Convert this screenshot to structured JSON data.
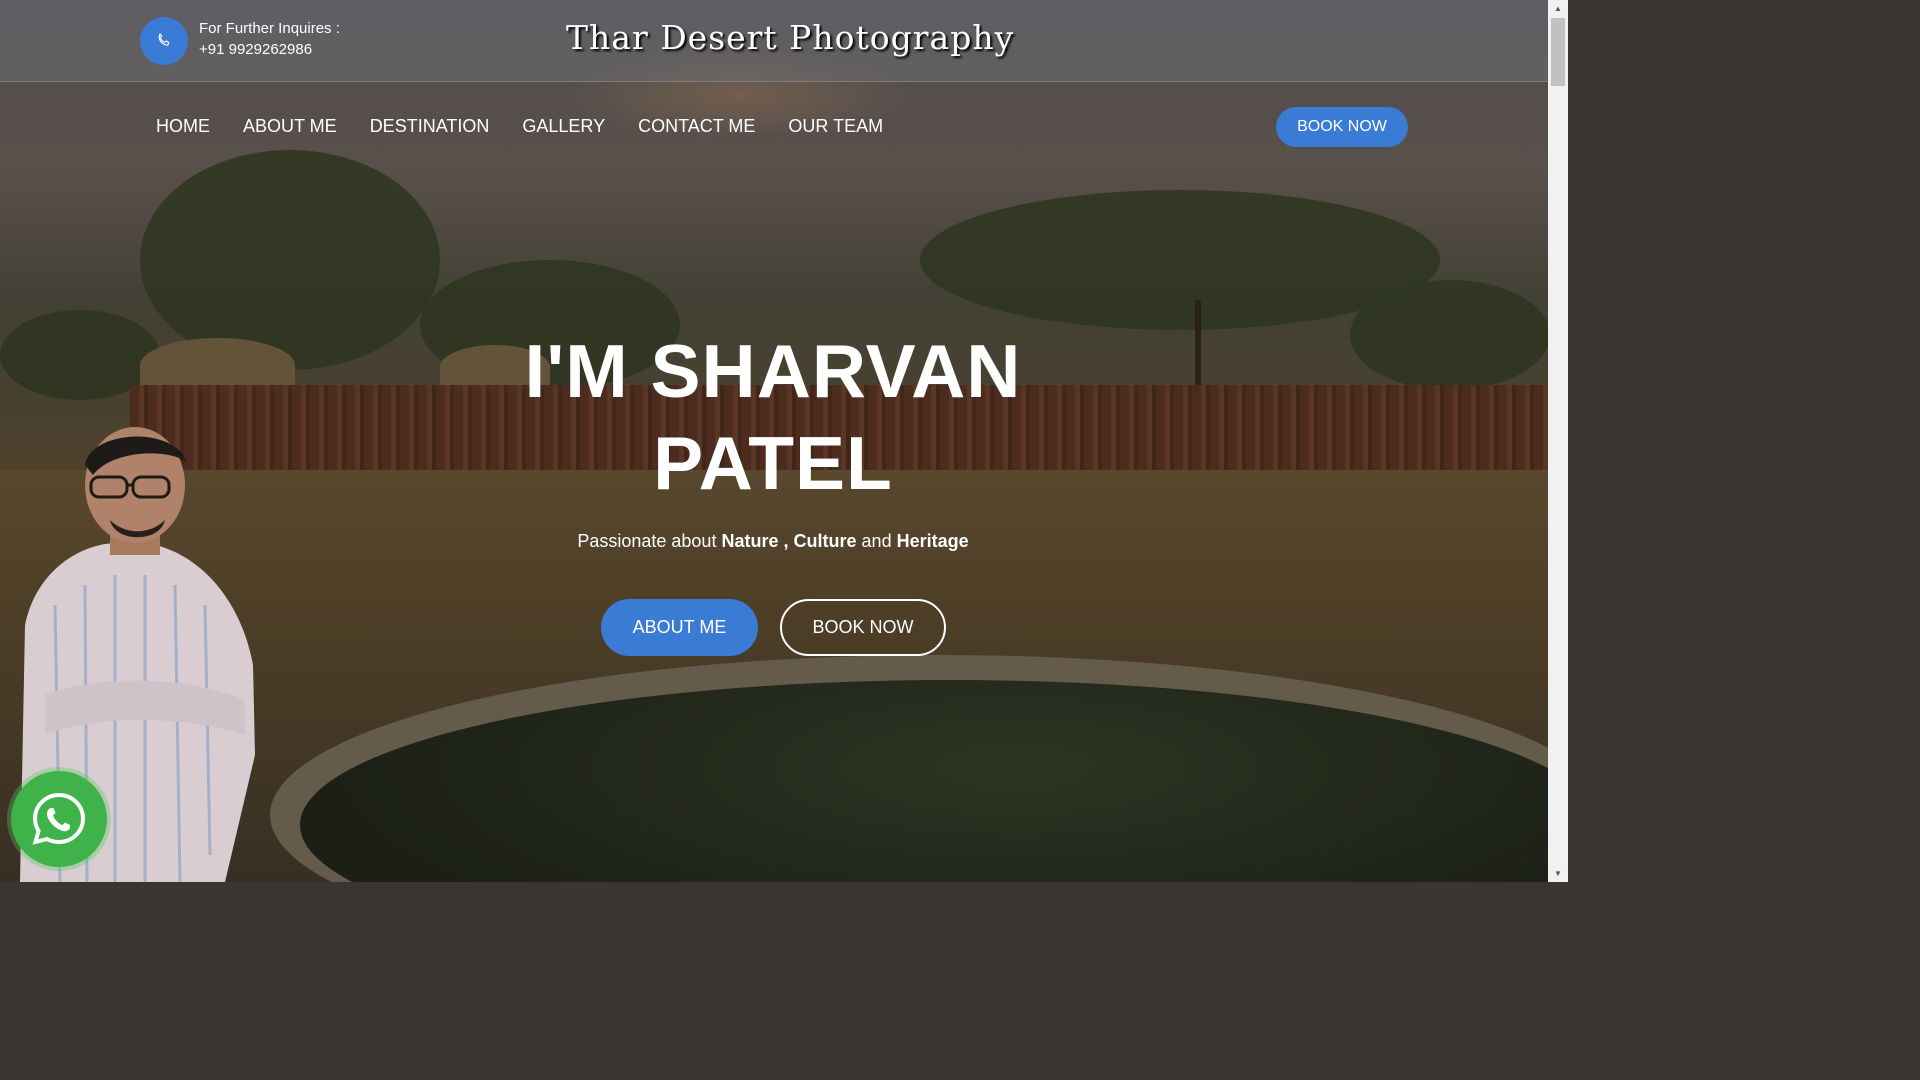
{
  "header": {
    "inquiry_label": "For Further Inquires :",
    "phone": "+91 9929262986",
    "site_title": "Thar Desert Photography",
    "icon": "phone-icon"
  },
  "nav": {
    "items": [
      "HOME",
      "ABOUT ME",
      "DESTINATION",
      "GALLERY",
      "CONTACT ME",
      "OUR TEAM"
    ],
    "book_label": "BOOK NOW"
  },
  "hero": {
    "headline_line1": "I'M SHARVAN",
    "headline_line2": "PATEL",
    "tagline_prefix": "Passionate about",
    "tagline_word1": "Nature",
    "tagline_sep": ",",
    "tagline_word2": "Culture",
    "tagline_and": "and",
    "tagline_word3": "Heritage",
    "about_button": "ABOUT ME",
    "book_button": "BOOK NOW"
  },
  "floating": {
    "whatsapp_icon": "whatsapp-icon"
  },
  "colors": {
    "accent": "#3a7bd5",
    "whatsapp": "#3fb34a"
  }
}
